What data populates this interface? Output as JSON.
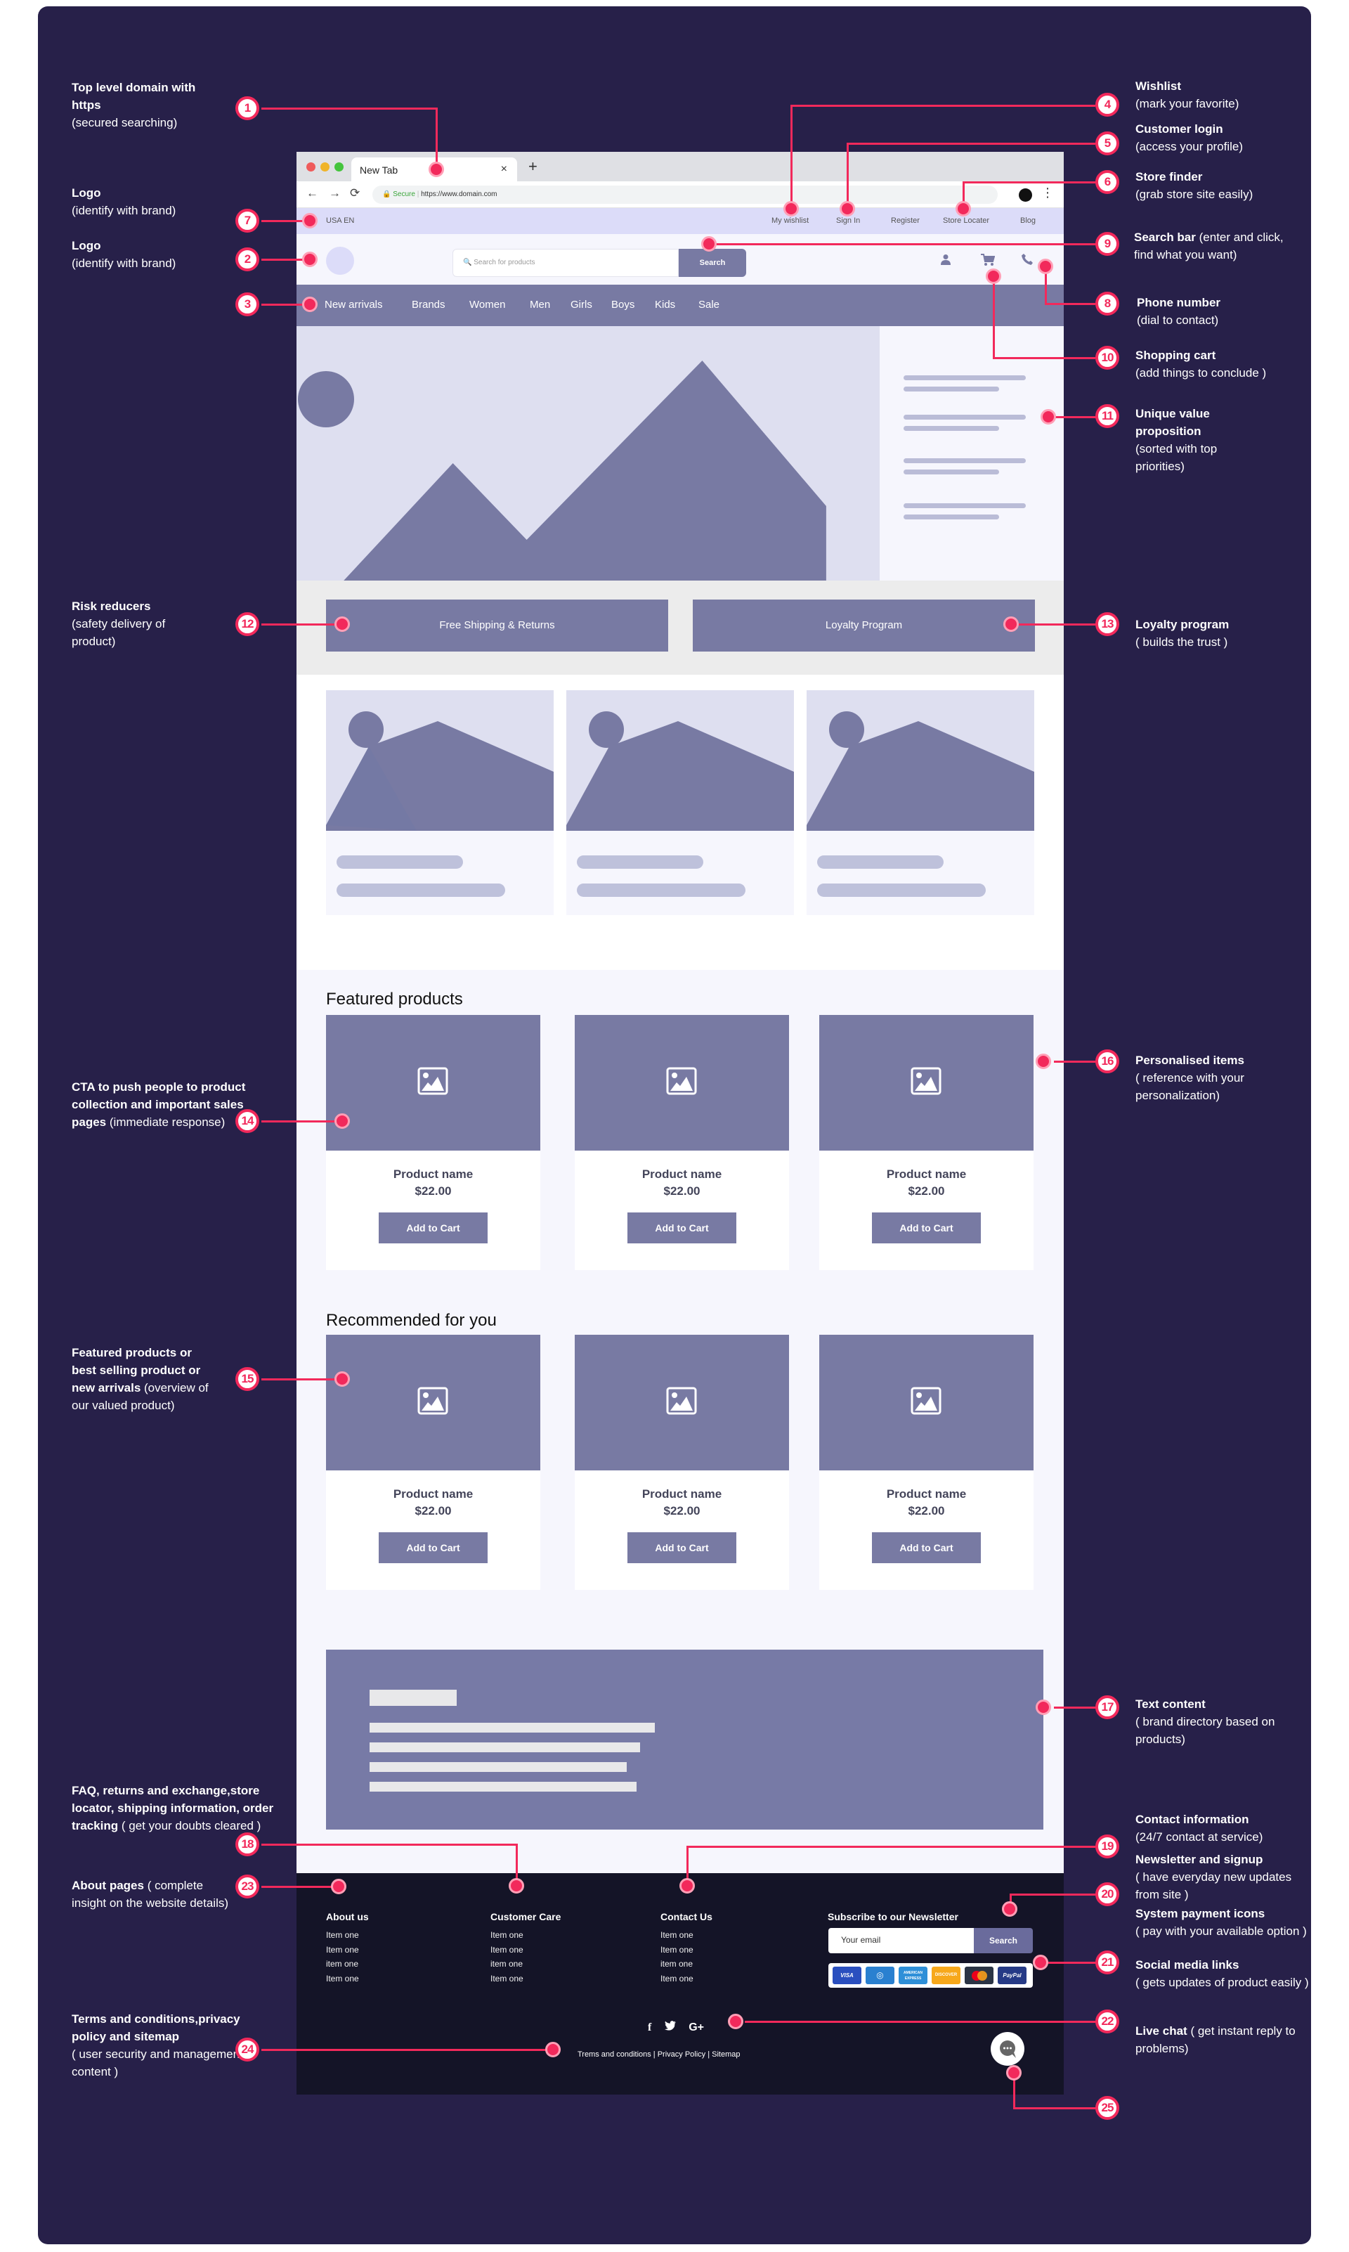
{
  "annotations": [
    {
      "num": "1",
      "title": "Top level domain with https",
      "desc": "(secured searching)"
    },
    {
      "num": "2",
      "title": "Logo",
      "desc": "(identify with brand)"
    },
    {
      "num": "3",
      "title": "",
      "desc": ""
    },
    {
      "num": "4",
      "title": "Wishlist",
      "desc": "(mark your favorite)"
    },
    {
      "num": "5",
      "title": "Customer login",
      "desc": "(access your profile)"
    },
    {
      "num": "6",
      "title": "Store finder",
      "desc": "(grab store site easily)"
    },
    {
      "num": "7",
      "title": "Logo",
      "desc": "(identify with brand)"
    },
    {
      "num": "8",
      "title": "Phone number",
      "desc": "(dial to contact)"
    },
    {
      "num": "9",
      "title": "Search bar",
      "desc": "(enter and click, find what you want)"
    },
    {
      "num": "10",
      "title": "Shopping cart",
      "desc": "(add things to conclude )"
    },
    {
      "num": "11",
      "title": "Unique value proposition",
      "desc": "(sorted with top priorities)"
    },
    {
      "num": "12",
      "title": "Risk reducers",
      "desc": "(safety delivery of product)"
    },
    {
      "num": "13",
      "title": "Loyalty program",
      "desc": "( builds the trust )"
    },
    {
      "num": "14",
      "title": "CTA to push people to product collection and important sales pages",
      "desc": "(immediate response)"
    },
    {
      "num": "15",
      "title": "Featured products or best selling product or new arrivals",
      "desc": "(overview of our valued product)"
    },
    {
      "num": "16",
      "title": "Personalised items",
      "desc": "( reference with your personalization)"
    },
    {
      "num": "17",
      "title": "Text content",
      "desc": "( brand directory based on products)"
    },
    {
      "num": "18",
      "title": "FAQ, returns and exchange,store locator, shipping information, order tracking",
      "desc": "( get your doubts cleared )"
    },
    {
      "num": "19",
      "title": "Contact information",
      "desc": "(24/7 contact at service)"
    },
    {
      "num": "20",
      "title": "Newsletter and signup",
      "desc": "( have everyday new updates from site )"
    },
    {
      "num": "21",
      "title": "System payment icons",
      "desc": "( pay with your available option )"
    },
    {
      "num": "22",
      "title": "Social media links",
      "desc": "( gets updates of product easily )"
    },
    {
      "num": "23",
      "title": "About pages",
      "desc": "( complete insight on the website details)"
    },
    {
      "num": "24",
      "title": "Terms and conditions,privacy policy and sitemap",
      "desc": "( user security and management content )"
    },
    {
      "num": "25",
      "title": "Live chat",
      "desc": "( get instant reply to problems)"
    }
  ],
  "browser": {
    "tab_title": "New Tab",
    "tab_close": "×",
    "new_tab": "+",
    "back": "←",
    "forward": "→",
    "reload": "⟳",
    "secure_label": "Secure",
    "url": "https://www.domain.com",
    "menu": "⋮"
  },
  "topbar": {
    "locale": "USA EN",
    "links": [
      "My wishlist",
      "Sign In",
      "Register",
      "Store Locater",
      "Blog"
    ]
  },
  "header": {
    "search_placeholder": "Search for products",
    "search_button": "Search",
    "icons": [
      "user-icon",
      "cart-icon",
      "phone-icon"
    ]
  },
  "nav": {
    "items": [
      "New arrivals",
      "Brands",
      "Women",
      "Men",
      "Girls",
      "Boys",
      "Kids",
      "Sale"
    ]
  },
  "risk": {
    "shipping": "Free Shipping & Returns",
    "loyalty": "Loyalty Program"
  },
  "featured": {
    "title": "Featured products",
    "products": [
      {
        "name": "Product name",
        "price": "$22.00",
        "button": "Add to Cart"
      },
      {
        "name": "Product name",
        "price": "$22.00",
        "button": "Add to Cart"
      },
      {
        "name": "Product name",
        "price": "$22.00",
        "button": "Add to Cart"
      }
    ]
  },
  "recommended": {
    "title": "Recommended for you",
    "products": [
      {
        "name": "Product name",
        "price": "$22.00",
        "button": "Add to Cart"
      },
      {
        "name": "Product name",
        "price": "$22.00",
        "button": "Add to Cart"
      },
      {
        "name": "Product name",
        "price": "$22.00",
        "button": "Add to Cart"
      }
    ]
  },
  "footer": {
    "columns": [
      {
        "title": "About us",
        "items": [
          "Item one",
          "Item one",
          "item one",
          "Item one"
        ]
      },
      {
        "title": "Customer Care",
        "items": [
          "Item one",
          "Item one",
          "item one",
          "Item one"
        ]
      },
      {
        "title": "Contact Us",
        "items": [
          "Item one",
          "Item one",
          "item one",
          "Item one"
        ]
      }
    ],
    "newsletter": {
      "title": "Subscribe to our Newsletter",
      "placeholder": "Your email",
      "button": "Search"
    },
    "payments": [
      {
        "name": "VISA",
        "color": "#2a4fbf"
      },
      {
        "name": "Diners",
        "color": "#2a80d0"
      },
      {
        "name": "AMERICAN EXPRESS",
        "color": "#2e8fd8"
      },
      {
        "name": "DISCOVER",
        "color": "#f7a81b"
      },
      {
        "name": "MasterCard",
        "color": "#2b3445"
      },
      {
        "name": "PayPal",
        "color": "#263a86"
      }
    ],
    "social": [
      "f",
      "🐦",
      "G+"
    ],
    "legal": "Trems and conditions | Privacy Policy | Sitemap"
  },
  "colors": {
    "panel": "#272049",
    "accent": "#f2295b",
    "wire": "#787aa3",
    "lavender": "#dcdcf9",
    "footer": "#141427"
  }
}
